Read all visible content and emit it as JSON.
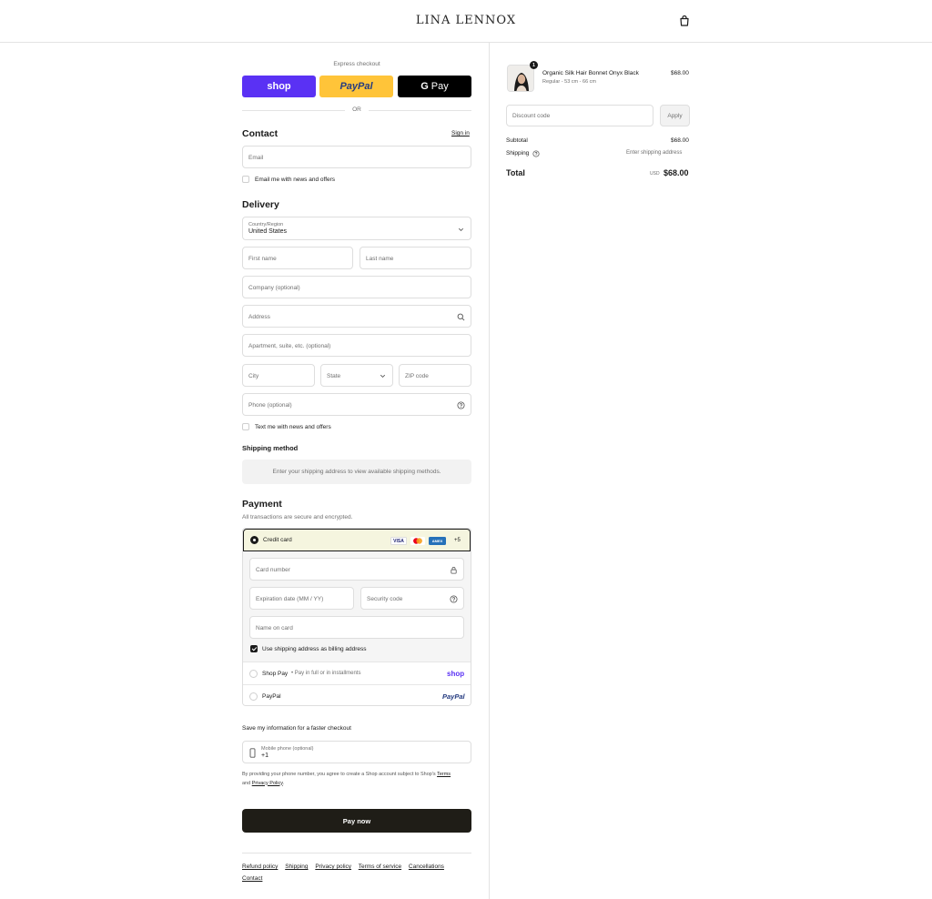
{
  "header": {
    "logo": "LINA LENNOX",
    "cart_icon": "shopping-bag-icon"
  },
  "express": {
    "title": "Express checkout",
    "shop_label": "shop",
    "paypal_label": "PayPal",
    "gpay_g": "G",
    "gpay_label": "Pay",
    "or_label": "OR"
  },
  "contact": {
    "title": "Contact",
    "sign_in": "Sign in",
    "email_placeholder": "Email",
    "news_label": "Email me with news and offers"
  },
  "delivery": {
    "title": "Delivery",
    "country_label": "Country/Region",
    "country_value": "United States",
    "first_name": "First name",
    "last_name": "Last name",
    "company": "Company (optional)",
    "address": "Address",
    "apartment": "Apartment, suite, etc. (optional)",
    "city": "City",
    "state": "State",
    "zip": "ZIP code",
    "phone": "Phone (optional)",
    "text_label": "Text me with news and offers"
  },
  "shipping_method": {
    "title": "Shipping method",
    "message": "Enter your shipping address to view available shipping methods."
  },
  "payment": {
    "title": "Payment",
    "subtitle": "All transactions are secure and encrypted.",
    "credit_card": "Credit card",
    "more_cards": "+5",
    "visa": "VISA",
    "amex": "AMEX",
    "card_number": "Card number",
    "expiration": "Expiration date (MM / YY)",
    "security": "Security code",
    "name_on_card": "Name on card",
    "billing_label": "Use shipping address as billing address",
    "shop_pay_title": "Shop Pay",
    "shop_pay_sub": "• Pay in full or in installments",
    "shop_logo": "shop",
    "paypal": "PayPal",
    "paypal_logo": "PayPal"
  },
  "save": {
    "title": "Save my information for a faster checkout",
    "mobile_label": "Mobile phone (optional)",
    "mobile_value": "+1",
    "disclaimer_pre": "By providing your phone number, you agree to create a Shop account subject to Shop's",
    "terms": "Terms",
    "and": "and",
    "privacy": "Privacy Policy",
    "period": "."
  },
  "pay_now": "Pay now",
  "footer": {
    "refund": "Refund policy",
    "shipping": "Shipping",
    "privacy": "Privacy policy",
    "terms": "Terms of service",
    "cancellations": "Cancellations",
    "contact": "Contact"
  },
  "summary": {
    "qty_badge": "1",
    "product_name": "Organic Silk Hair Bonnet Onyx Black",
    "product_variant": "Regular - 53 cm - 66 cm",
    "product_price": "$68.00",
    "discount_placeholder": "Discount code",
    "apply": "Apply",
    "subtotal_label": "Subtotal",
    "subtotal_value": "$68.00",
    "shipping_label": "Shipping",
    "shipping_value": "Enter shipping address",
    "total_label": "Total",
    "currency": "USD",
    "total_value": "$68.00"
  },
  "colors": {
    "shop_purple": "#5a31f4",
    "paypal_yellow": "#ffc439",
    "dark_button": "#1f1d17",
    "selected_bg": "#f5f5df"
  }
}
